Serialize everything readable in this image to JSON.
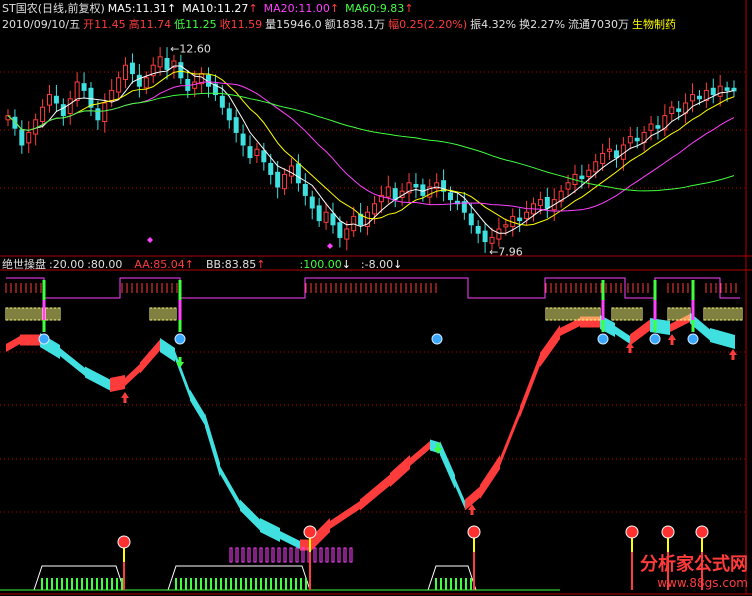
{
  "header": {
    "title": "ST国农(日线,前复权)",
    "ma5": "MA5:11.31",
    "ma10": "MA10:11.27",
    "ma20": "MA20:11.00",
    "ma60": "MA60:9.83",
    "arrow": "↑",
    "date": "2010/09/10/五",
    "open": "开11.45",
    "high": "高11.74",
    "low": "低11.25",
    "close": "收11.59",
    "volume": "量15946.0",
    "amount": "额1838.1万",
    "change": "幅0.25(2.20%)",
    "amplitude": "振4.32%",
    "turnover": "换2.27%",
    "float": "流通7030万",
    "sector": "生物制药"
  },
  "colors": {
    "up": "#ff3c3c",
    "down": "#40e0e0",
    "ma5": "#ffffff",
    "ma10": "#ffff00",
    "ma20": "#ff40ff",
    "ma60": "#40ff40",
    "grid": "#b00000"
  },
  "indicator": {
    "name": "绝世操盘",
    "p1": ":20.00",
    "p2": ":80.00",
    "aa": "AA:85.04",
    "bb": "BB:83.85",
    "v1": ":100.00",
    "v2": ":-8.00"
  },
  "chart_data": {
    "type": "candlestick",
    "price_annotations": [
      {
        "label": "12.60",
        "value": 12.6
      },
      {
        "label": "7.96",
        "value": 7.96
      }
    ],
    "closes": [
      11.0,
      10.7,
      10.3,
      10.6,
      10.9,
      11.2,
      11.5,
      11.3,
      11.0,
      11.4,
      11.8,
      11.6,
      11.2,
      10.9,
      11.3,
      11.6,
      11.9,
      12.2,
      12.0,
      11.7,
      11.9,
      12.2,
      12.4,
      12.1,
      12.3,
      11.9,
      11.6,
      11.8,
      12.0,
      11.7,
      11.5,
      11.2,
      10.9,
      10.6,
      10.3,
      10.0,
      10.2,
      9.9,
      9.6,
      9.3,
      9.6,
      9.8,
      9.4,
      9.1,
      8.8,
      8.5,
      8.7,
      8.4,
      8.1,
      8.3,
      8.6,
      8.4,
      8.7,
      8.9,
      9.1,
      9.3,
      9.0,
      9.2,
      9.4,
      9.3,
      9.1,
      9.3,
      9.4,
      9.2,
      9.0,
      8.9,
      8.7,
      8.4,
      8.2,
      8.0,
      8.1,
      8.3,
      8.4,
      8.6,
      8.5,
      8.7,
      8.9,
      9.0,
      8.8,
      9.0,
      9.2,
      9.4,
      9.6,
      9.5,
      9.7,
      9.9,
      10.1,
      10.2,
      10.0,
      10.3,
      10.5,
      10.4,
      10.6,
      10.8,
      10.7,
      11.0,
      11.2,
      11.1,
      11.3,
      11.5,
      11.4,
      11.6,
      11.5,
      11.7,
      11.6,
      11.59
    ]
  }
}
